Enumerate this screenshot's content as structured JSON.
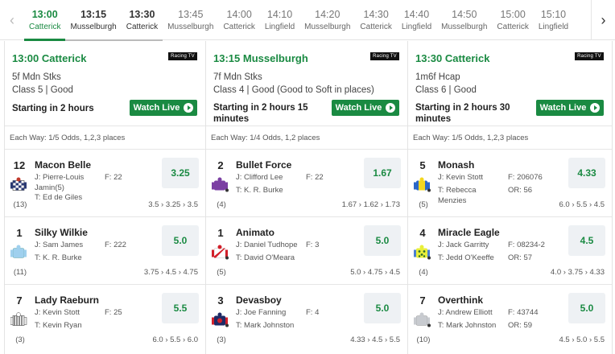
{
  "tabs": [
    {
      "time": "13:00",
      "course": "Catterick",
      "state": "active"
    },
    {
      "time": "13:15",
      "course": "Musselburgh",
      "state": "seen"
    },
    {
      "time": "13:30",
      "course": "Catterick",
      "state": "seen"
    },
    {
      "time": "13:45",
      "course": "Musselburgh",
      "state": ""
    },
    {
      "time": "14:00",
      "course": "Catterick",
      "state": ""
    },
    {
      "time": "14:10",
      "course": "Lingfield",
      "state": ""
    },
    {
      "time": "14:20",
      "course": "Musselburgh",
      "state": ""
    },
    {
      "time": "14:30",
      "course": "Catterick",
      "state": ""
    },
    {
      "time": "14:40",
      "course": "Lingfield",
      "state": ""
    },
    {
      "time": "14:50",
      "course": "Musselburgh",
      "state": ""
    },
    {
      "time": "15:00",
      "course": "Catterick",
      "state": ""
    },
    {
      "time": "15:10",
      "course": "Lingfield",
      "state": ""
    }
  ],
  "nav": {
    "prev_icon": "‹",
    "next_icon": "›"
  },
  "colors": {
    "accent": "#1a8a42",
    "odds_bg": "#eef1f4"
  },
  "races": [
    {
      "title": "13:00 Catterick",
      "broadcaster": "Racing TV",
      "type": "5f Mdn Stks",
      "class": "Class 5 | Good",
      "start": "Starting in 2 hours",
      "watch": "Watch Live",
      "each_way": "Each Way: 1/5 Odds, 1,2,3 places",
      "runners": [
        {
          "num": "12",
          "name": "Macon Belle",
          "jockey": "J: Pierre-Louis Jamin(5)",
          "trainer": "T: Ed de Giles",
          "form": "F: 22",
          "or": "",
          "draw": "(13)",
          "odds": "3.25",
          "history": "3.5 › 3.25 › 3.5",
          "silk": "checks-navy"
        },
        {
          "num": "1",
          "name": "Silky Wilkie",
          "jockey": "J: Sam James",
          "trainer": "T: K. R. Burke",
          "form": "F: 222",
          "or": "",
          "draw": "(11)",
          "odds": "5.0",
          "history": "3.75 › 4.5 › 4.75",
          "silk": "lightblue"
        },
        {
          "num": "7",
          "name": "Lady Raeburn",
          "jockey": "J: Kevin Stott",
          "trainer": "T: Kevin Ryan",
          "form": "F: 25",
          "or": "",
          "draw": "(3)",
          "odds": "5.5",
          "history": "6.0 › 5.5 › 6.0",
          "silk": "stripes-grey"
        }
      ]
    },
    {
      "title": "13:15 Musselburgh",
      "broadcaster": "Racing TV",
      "type": "7f Mdn Stks",
      "class": "Class 4 | Good (Good to Soft in places)",
      "start": "Starting in 2 hours 15 minutes",
      "watch": "Watch Live",
      "each_way": "Each Way: 1/4 Odds, 1,2 places",
      "runners": [
        {
          "num": "2",
          "name": "Bullet Force",
          "jockey": "J: Clifford Lee",
          "trainer": "T: K. R. Burke",
          "form": "F: 22",
          "or": "",
          "draw": "(4)",
          "odds": "1.67",
          "history": "1.67 › 1.62 › 1.73",
          "silk": "purple"
        },
        {
          "num": "1",
          "name": "Animato",
          "jockey": "J: Daniel Tudhope",
          "trainer": "T: David O'Meara",
          "form": "F: 3",
          "or": "",
          "draw": "(5)",
          "odds": "5.0",
          "history": "5.0 › 4.75 › 4.5",
          "silk": "red-sash"
        },
        {
          "num": "3",
          "name": "Devasboy",
          "jockey": "J: Joe Fanning",
          "trainer": "T: Mark Johnston",
          "form": "F: 4",
          "or": "",
          "draw": "(3)",
          "odds": "5.0",
          "history": "4.33 › 4.5 › 5.5",
          "silk": "navy-red"
        }
      ]
    },
    {
      "title": "13:30 Catterick",
      "broadcaster": "Racing TV",
      "type": "1m6f Hcap",
      "class": "Class 6 | Good",
      "start": "Starting in 2 hours 30 minutes",
      "watch": "Watch Live",
      "each_way": "Each Way: 1/5 Odds, 1,2,3 places",
      "runners": [
        {
          "num": "5",
          "name": "Monash",
          "jockey": "J: Kevin Stott",
          "trainer": "T: Rebecca Menzies",
          "form": "F: 206076",
          "or": "OR: 56",
          "draw": "(5)",
          "odds": "4.33",
          "history": "6.0 › 5.5 › 4.5",
          "silk": "blue-yellow"
        },
        {
          "num": "4",
          "name": "Miracle Eagle",
          "jockey": "J: Jack Garritty",
          "trainer": "T: Jedd O'Keeffe",
          "form": "F: 08234-2",
          "or": "OR: 57",
          "draw": "(4)",
          "odds": "4.5",
          "history": "4.0 › 3.75 › 4.33",
          "silk": "yellow-spots"
        },
        {
          "num": "7",
          "name": "Overthink",
          "jockey": "J: Andrew Elliott",
          "trainer": "T: Mark Johnston",
          "form": "F: 43744",
          "or": "OR: 59",
          "draw": "(10)",
          "odds": "5.0",
          "history": "4.5 › 5.0 › 5.5",
          "silk": "grey"
        }
      ]
    }
  ]
}
